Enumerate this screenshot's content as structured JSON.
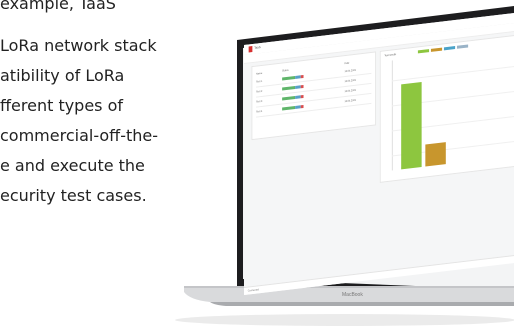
{
  "copy": {
    "lines": [
      "example, TaaS",
      "LoRa network stack",
      "atibility of LoRa",
      "fferent types of",
      "commercial-off-the-",
      "e and execute the",
      "ecurity test cases."
    ]
  },
  "laptop": {
    "brand": "MacBook"
  },
  "app": {
    "title": "TaaS",
    "status_text": "Connected",
    "table": {
      "columns": [
        "Name",
        "Status",
        "",
        "Date"
      ],
      "rows": [
        [
          "Test 1",
          "",
          "",
          "12.04.2021"
        ],
        [
          "Test 2",
          "",
          "",
          "12.04.2021"
        ],
        [
          "Test 3",
          "",
          "",
          "12.04.2021"
        ],
        [
          "Test 4",
          "",
          "",
          "12.04.2021"
        ]
      ]
    },
    "chart": {
      "title": "Test results",
      "colors": [
        "#8dc63f",
        "#c8962d",
        "#4aa3c9",
        "#9ab3c7"
      ]
    }
  },
  "chart_data": {
    "type": "bar",
    "categories": [
      "",
      ""
    ],
    "values": [
      85,
      22
    ],
    "colors": [
      "#8dc63f",
      "#c8962d"
    ],
    "title": "",
    "xlabel": "",
    "ylabel": "",
    "ylim": [
      0,
      100
    ]
  }
}
